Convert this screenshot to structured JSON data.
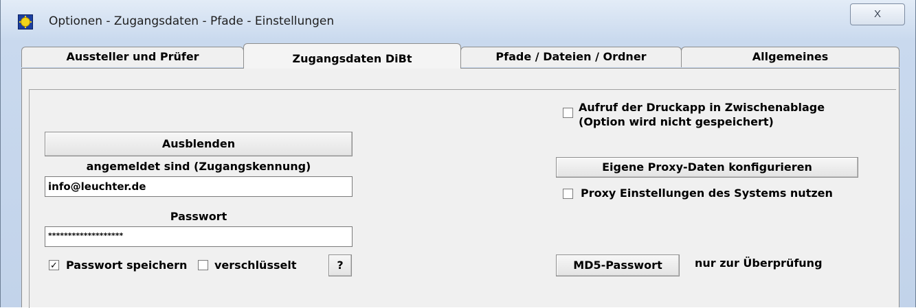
{
  "window": {
    "title": "Optionen - Zugangsdaten -  Pfade - Einstellungen",
    "close_glyph": "X"
  },
  "tabs": [
    {
      "label": "Aussteller und Prüfer",
      "active": false
    },
    {
      "label": "Zugangsdaten DiBt",
      "active": true
    },
    {
      "label": "Pfade / Dateien / Ordner",
      "active": false
    },
    {
      "label": "Allgemeines",
      "active": false
    }
  ],
  "left": {
    "hide_button": "Ausblenden",
    "login_label": "angemeldet sind (Zugangskennung)",
    "login_value": "info@leuchter.de",
    "password_label": "Passwort",
    "password_value": "*******************",
    "save_password": {
      "label": "Passwort speichern",
      "checked": true,
      "mark": "✓"
    },
    "encrypted": {
      "label": "verschlüsselt",
      "checked": false
    },
    "help_button": "?"
  },
  "right": {
    "clipboard_option": {
      "line1": "Aufruf der Druckapp in Zwischenablage",
      "line2": "(Option wird nicht gespeichert)",
      "checked": false
    },
    "proxy_button": "Eigene Proxy-Daten konfigurieren",
    "system_proxy": {
      "label": "Proxy Einstellungen des Systems nutzen",
      "checked": false
    },
    "md5_button": "MD5-Passwort",
    "md5_note": "nur zur Überprüfung"
  }
}
